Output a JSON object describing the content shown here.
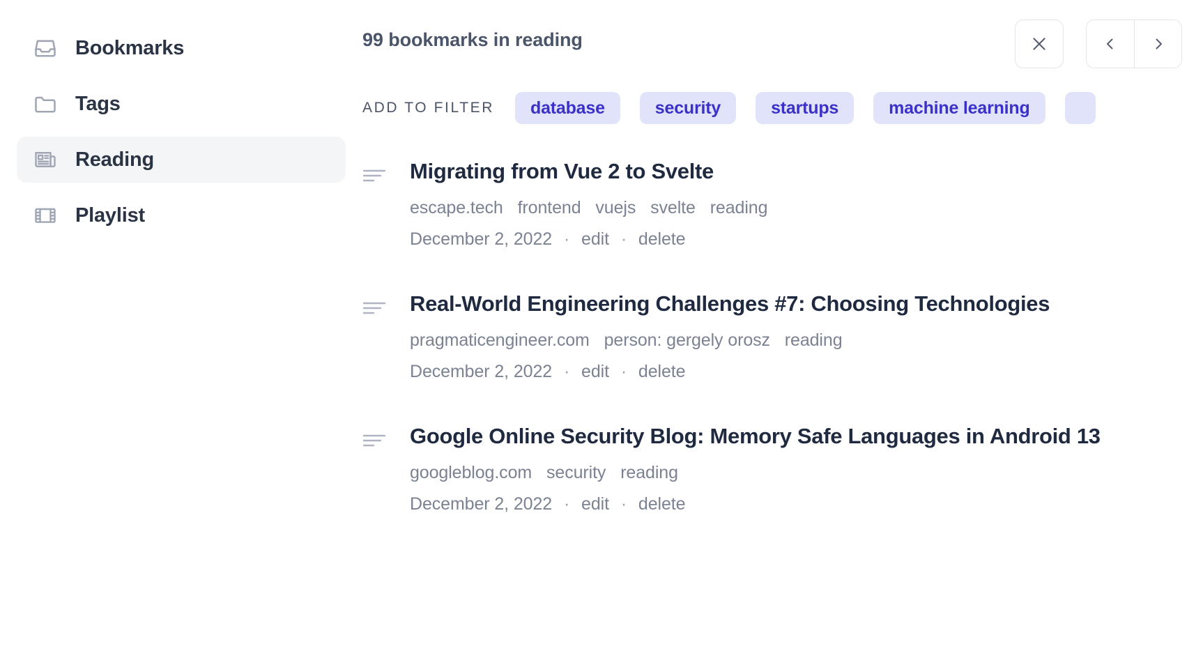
{
  "sidebar": {
    "items": [
      {
        "label": "Bookmarks",
        "icon": "inbox-icon",
        "active": false
      },
      {
        "label": "Tags",
        "icon": "folder-icon",
        "active": false
      },
      {
        "label": "Reading",
        "icon": "newspaper-icon",
        "active": true
      },
      {
        "label": "Playlist",
        "icon": "film-icon",
        "active": false
      }
    ]
  },
  "header": {
    "count_title": "99 bookmarks in reading",
    "close_icon": "close-icon",
    "prev_icon": "chevron-left-icon",
    "next_icon": "chevron-right-icon"
  },
  "filter": {
    "label": "ADD TO FILTER",
    "chips": [
      {
        "label": "database"
      },
      {
        "label": "security"
      },
      {
        "label": "startups"
      },
      {
        "label": "machine learning"
      },
      {
        "label": ""
      }
    ]
  },
  "bookmarks": [
    {
      "title": "Migrating from Vue 2 to Svelte",
      "tags": [
        "escape.tech",
        "frontend",
        "vuejs",
        "svelte",
        "reading"
      ],
      "date": "December 2, 2022",
      "edit_label": "edit",
      "delete_label": "delete",
      "separator": "·",
      "handle_icon": "drag-handle-icon"
    },
    {
      "title": "Real-World Engineering Challenges #7: Choosing Technologies",
      "tags": [
        "pragmaticengineer.com",
        "person: gergely orosz",
        "reading"
      ],
      "date": "December 2, 2022",
      "edit_label": "edit",
      "delete_label": "delete",
      "separator": "·",
      "handle_icon": "drag-handle-icon"
    },
    {
      "title": "Google Online Security Blog: Memory Safe Languages in Android 13",
      "tags": [
        "googleblog.com",
        "security",
        "reading"
      ],
      "date": "December 2, 2022",
      "edit_label": "edit",
      "delete_label": "delete",
      "separator": "·",
      "handle_icon": "drag-handle-icon"
    }
  ],
  "colors": {
    "chip_bg": "#e1e3fb",
    "chip_text": "#3a31c8",
    "title_text": "#1f2a40",
    "muted_text": "#7b8292",
    "active_nav_bg": "#f4f5f7",
    "border": "#e2e5ea"
  }
}
